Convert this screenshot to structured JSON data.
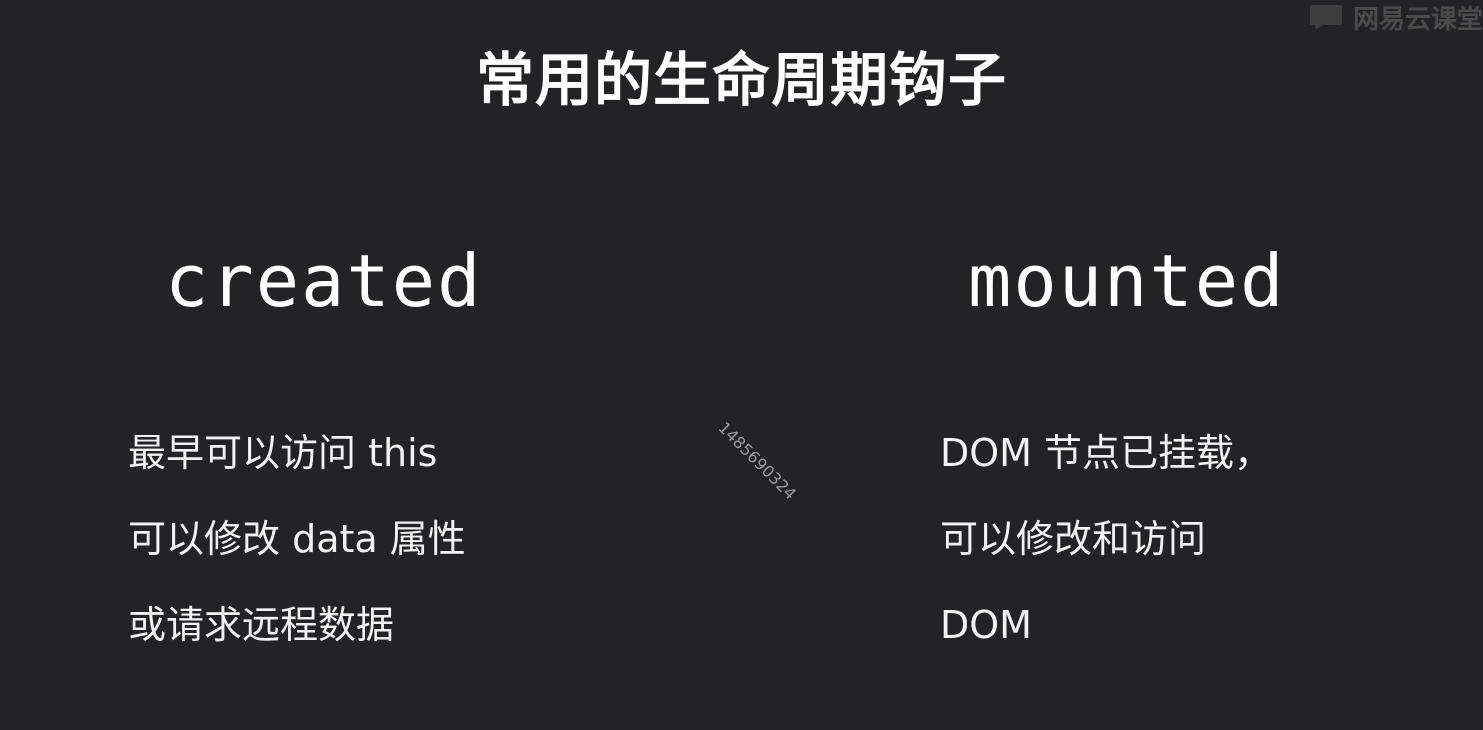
{
  "slide": {
    "title": "常用的生命周期钩子",
    "left": {
      "hook": "created",
      "lines": [
        "最早可以访问 this",
        "可以修改 data 属性",
        "或请求远程数据"
      ]
    },
    "right": {
      "hook": "mounted",
      "lines": [
        "DOM 节点已挂载，",
        "可以修改和访问",
        "DOM"
      ]
    }
  },
  "overlay": {
    "watermark_text": "1485690324",
    "brand_text": "网易云课堂",
    "brand_icon": "chat-bubble-icon",
    "colors": {
      "background": "#232326",
      "brand": "#4a4a4a",
      "watermark": "#9a9a9a"
    }
  }
}
